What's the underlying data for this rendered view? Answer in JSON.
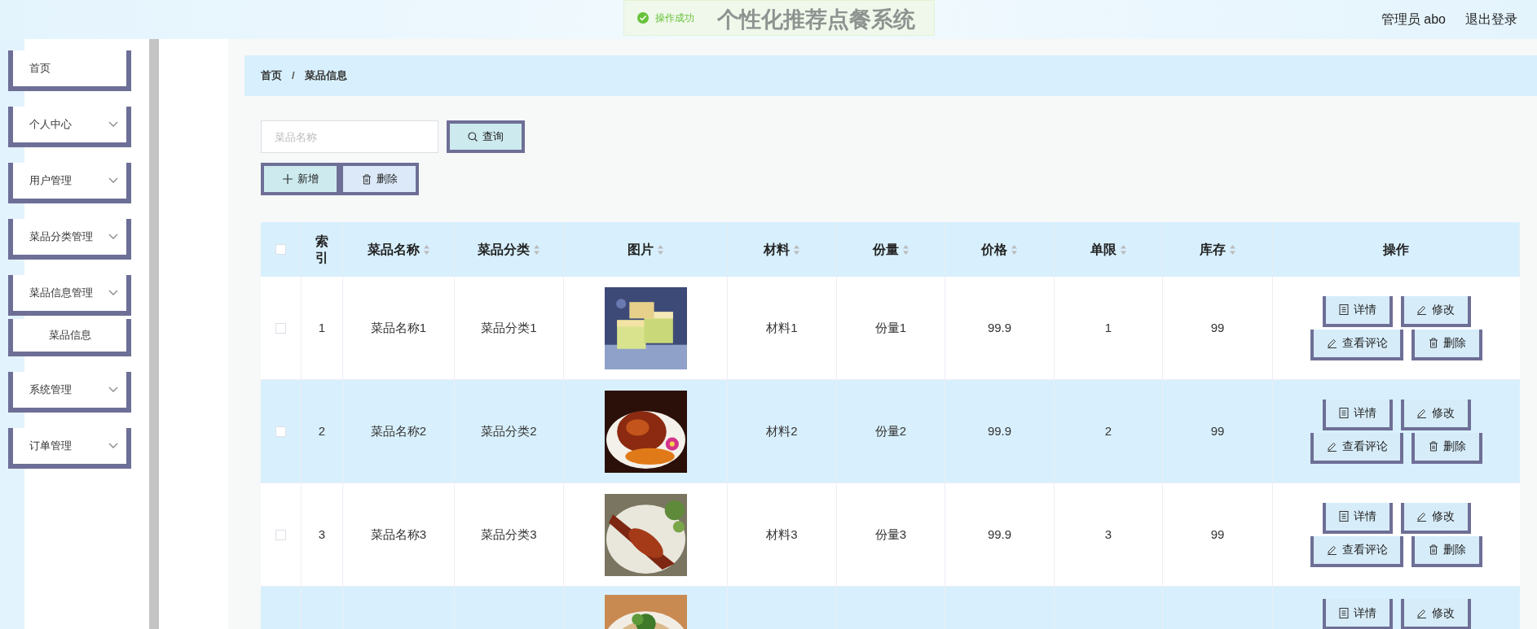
{
  "header": {
    "toast": "操作成功",
    "title": "个性化推荐点餐系统",
    "user": "管理员 abo",
    "logout": "退出登录"
  },
  "sidebar": {
    "items": [
      {
        "label": "首页",
        "kind": "link"
      },
      {
        "label": "个人中心",
        "kind": "menu"
      },
      {
        "label": "用户管理",
        "kind": "menu"
      },
      {
        "label": "菜品分类管理",
        "kind": "menu"
      },
      {
        "label": "菜品信息管理",
        "kind": "menu",
        "children": [
          {
            "label": "菜品信息"
          }
        ]
      },
      {
        "label": "系统管理",
        "kind": "menu"
      },
      {
        "label": "订单管理",
        "kind": "menu"
      }
    ]
  },
  "breadcrumb": {
    "items": [
      "首页",
      "菜品信息"
    ],
    "separator": "/"
  },
  "search": {
    "placeholder": "菜品名称",
    "button": "查询"
  },
  "toolbar": [
    {
      "label": "新增",
      "kind": "add"
    },
    {
      "label": "删除",
      "kind": "delete"
    }
  ],
  "table": {
    "select_all_checked": false,
    "columns": [
      {
        "label": "索引",
        "sortable": false
      },
      {
        "label": "菜品名称",
        "sortable": true
      },
      {
        "label": "菜品分类",
        "sortable": true
      },
      {
        "label": "图片",
        "sortable": true
      },
      {
        "label": "材料",
        "sortable": true
      },
      {
        "label": "份量",
        "sortable": true
      },
      {
        "label": "价格",
        "sortable": true
      },
      {
        "label": "单限",
        "sortable": true
      },
      {
        "label": "库存",
        "sortable": true
      },
      {
        "label": "操作",
        "sortable": false
      }
    ],
    "rows": [
      {
        "checked": false,
        "cells": [
          "1",
          "菜品名称1",
          "菜品分类1",
          null,
          "材料1",
          "份量1",
          "99.9",
          "1",
          "99"
        ],
        "actions": [
          {
            "label": "详情",
            "kind": "detail"
          },
          {
            "label": "修改",
            "kind": "edit"
          },
          {
            "label": "查看评论",
            "kind": "edit"
          },
          {
            "label": "删除",
            "kind": "delete"
          }
        ]
      },
      {
        "checked": false,
        "cells": [
          "2",
          "菜品名称2",
          "菜品分类2",
          null,
          "材料2",
          "份量2",
          "99.9",
          "2",
          "99"
        ],
        "actions": [
          {
            "label": "详情",
            "kind": "detail"
          },
          {
            "label": "修改",
            "kind": "edit"
          },
          {
            "label": "查看评论",
            "kind": "edit"
          },
          {
            "label": "删除",
            "kind": "delete"
          }
        ]
      },
      {
        "checked": false,
        "cells": [
          "3",
          "菜品名称3",
          "菜品分类3",
          null,
          "材料3",
          "份量3",
          "99.9",
          "3",
          "99"
        ],
        "actions": [
          {
            "label": "详情",
            "kind": "detail"
          },
          {
            "label": "修改",
            "kind": "edit"
          },
          {
            "label": "查看评论",
            "kind": "edit"
          },
          {
            "label": "删除",
            "kind": "delete"
          }
        ]
      },
      {
        "actions": [
          {
            "label": "详情",
            "kind": "detail"
          },
          {
            "label": "修改",
            "kind": "edit"
          }
        ]
      }
    ]
  }
}
